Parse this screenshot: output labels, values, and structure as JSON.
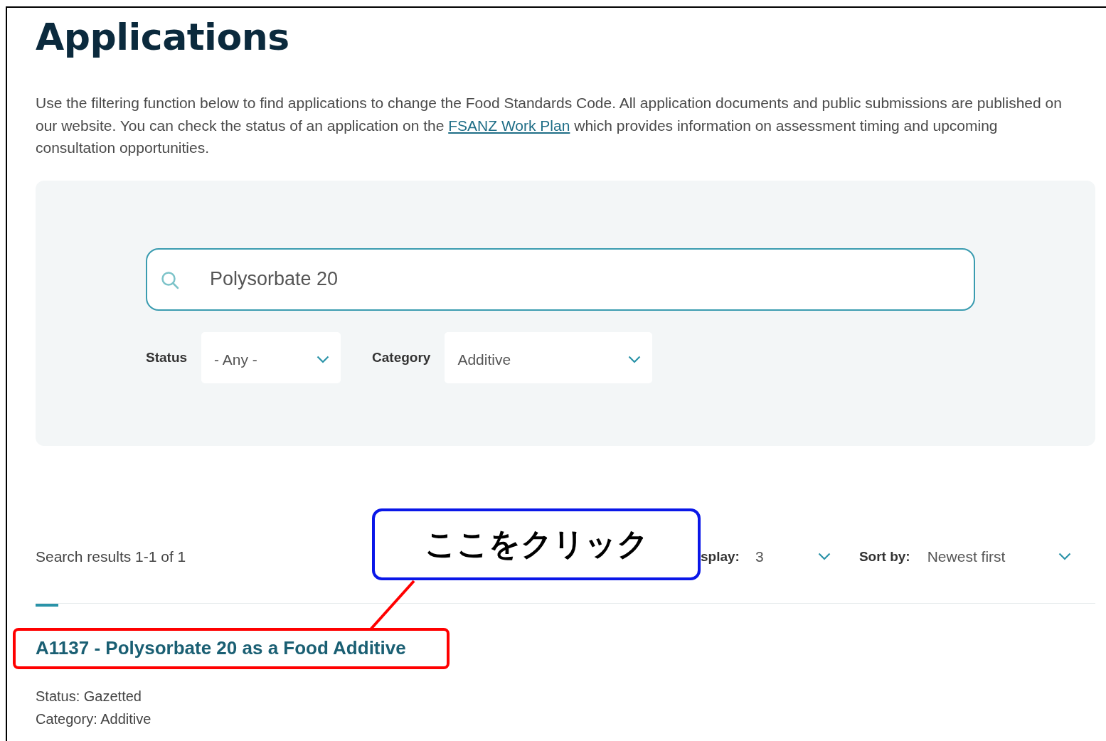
{
  "page": {
    "title": "Applications",
    "intro_before": "Use the filtering function below to find applications to change the Food Standards Code. All application documents and public submissions are published on our website. You can check the status of an application on the ",
    "intro_link": "FSANZ Work Plan",
    "intro_after": " which provides information on assessment timing and upcoming consultation opportunities."
  },
  "filters": {
    "search": {
      "value": "Polysorbate 20"
    },
    "dropdowns": [
      {
        "label": "Status",
        "value": "- Any -"
      },
      {
        "label": "Category",
        "value": "Additive"
      }
    ]
  },
  "results": {
    "summary": "Search results 1-1 of 1",
    "display_label": "splay:",
    "display_value": "3",
    "sort_label": "Sort by:",
    "sort_value": "Newest first",
    "items": [
      {
        "title": "A1137 - Polysorbate 20 as a Food Additive",
        "status": "Status: Gazetted",
        "category": "Category: Additive",
        "highlighted": true
      }
    ]
  },
  "annotation": {
    "text": "ここをクリック"
  }
}
